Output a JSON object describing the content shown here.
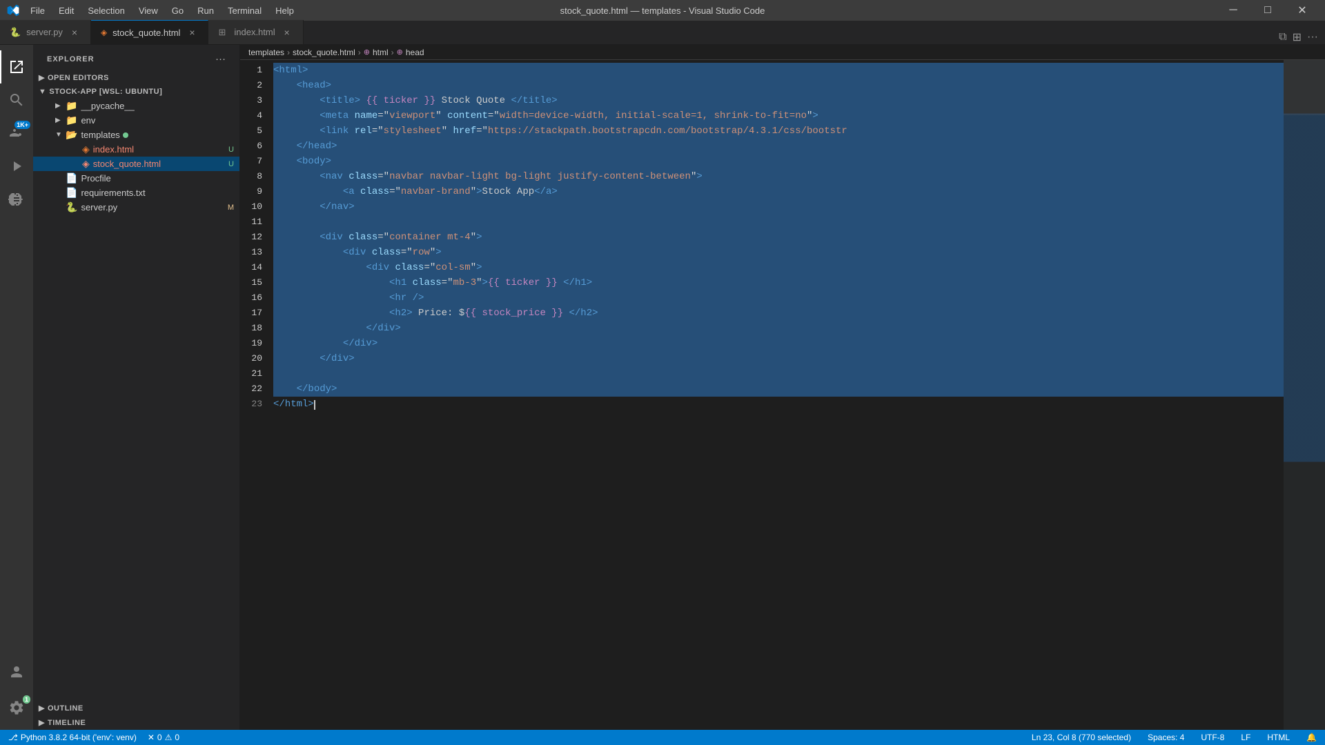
{
  "titleBar": {
    "title": "stock_quote.html — templates - Visual Studio Code",
    "menus": [
      "File",
      "Edit",
      "Selection",
      "View",
      "Go",
      "Run",
      "Terminal",
      "Help"
    ],
    "minimizeBtn": "─",
    "maximizeBtn": "□",
    "closeBtn": "✕"
  },
  "tabs": [
    {
      "id": "server-py",
      "label": "server.py",
      "icon": "py",
      "active": false,
      "modified": false
    },
    {
      "id": "stock-quote-html",
      "label": "stock_quote.html",
      "icon": "html",
      "active": true,
      "modified": false
    },
    {
      "id": "index-html",
      "label": "index.html",
      "icon": "html",
      "active": false,
      "modified": false
    }
  ],
  "activityBar": {
    "items": [
      {
        "id": "explorer",
        "icon": "📄",
        "active": true,
        "label": "Explorer"
      },
      {
        "id": "search",
        "icon": "🔍",
        "label": "Search"
      },
      {
        "id": "source-control",
        "icon": "⑂",
        "label": "Source Control",
        "badge": "1K+"
      },
      {
        "id": "run",
        "icon": "▶",
        "label": "Run"
      },
      {
        "id": "extensions",
        "icon": "⊞",
        "label": "Extensions"
      }
    ],
    "bottomItems": [
      {
        "id": "account",
        "icon": "👤",
        "label": "Account"
      },
      {
        "id": "settings",
        "icon": "⚙",
        "label": "Settings",
        "badge": "1"
      }
    ]
  },
  "sidebar": {
    "title": "EXPLORER",
    "openEditorsSection": "OPEN EDITORS",
    "projectSection": "STOCK-APP [WSL: UBUNTU]",
    "files": [
      {
        "type": "folder",
        "name": "__pycache__",
        "indent": 1,
        "expanded": false
      },
      {
        "type": "folder",
        "name": "env",
        "indent": 1,
        "expanded": false
      },
      {
        "type": "folder",
        "name": "templates",
        "indent": 1,
        "expanded": true,
        "modified": true
      },
      {
        "type": "file",
        "name": "index.html",
        "indent": 2,
        "badge": "U",
        "error": true
      },
      {
        "type": "file",
        "name": "stock_quote.html",
        "indent": 2,
        "badge": "U",
        "error": true,
        "selected": true
      },
      {
        "type": "file",
        "name": "Procfile",
        "indent": 1
      },
      {
        "type": "file",
        "name": "requirements.txt",
        "indent": 1
      },
      {
        "type": "file",
        "name": "server.py",
        "indent": 1,
        "badge": "M"
      }
    ],
    "outlineSection": "OUTLINE",
    "timelineSection": "TIMELINE"
  },
  "breadcrumb": {
    "items": [
      "templates",
      "stock_quote.html",
      "html",
      "head"
    ]
  },
  "editor": {
    "lines": [
      {
        "num": 1,
        "content": "<html>",
        "selected": true
      },
      {
        "num": 2,
        "content": "    <head>",
        "selected": true
      },
      {
        "num": 3,
        "content": "        <title> {{ ticker }} Stock Quote </title>",
        "selected": true
      },
      {
        "num": 4,
        "content": "        <meta name=\"viewport\" content=\"width=device-width, initial-scale=1, shrink-to-fit=no\">",
        "selected": true
      },
      {
        "num": 5,
        "content": "        <link rel=\"stylesheet\" href=\"https://stackpath.bootstrapcdn.com/bootstrap/4.3.1/css/bootstr",
        "selected": true
      },
      {
        "num": 6,
        "content": "    </head>",
        "selected": true
      },
      {
        "num": 7,
        "content": "    <body>",
        "selected": true
      },
      {
        "num": 8,
        "content": "        <nav class=\"navbar navbar-light bg-light justify-content-between\">",
        "selected": true
      },
      {
        "num": 9,
        "content": "            <a class=\"navbar-brand\">Stock App</a>",
        "selected": true
      },
      {
        "num": 10,
        "content": "        </nav>",
        "selected": true
      },
      {
        "num": 11,
        "content": "",
        "selected": true
      },
      {
        "num": 12,
        "content": "        <div class=\"container mt-4\">",
        "selected": true
      },
      {
        "num": 13,
        "content": "            <div class=\"row\">",
        "selected": true
      },
      {
        "num": 14,
        "content": "                <div class=\"col-sm\">",
        "selected": true
      },
      {
        "num": 15,
        "content": "                    <h1 class=\"mb-3\">{{ ticker }} </h1>",
        "selected": true
      },
      {
        "num": 16,
        "content": "                    <hr />",
        "selected": true
      },
      {
        "num": 17,
        "content": "                    <h2> Price: ${{ stock_price }} </h2>",
        "selected": true
      },
      {
        "num": 18,
        "content": "                </div>",
        "selected": true
      },
      {
        "num": 19,
        "content": "            </div>",
        "selected": true
      },
      {
        "num": 20,
        "content": "        </div>",
        "selected": true
      },
      {
        "num": 21,
        "content": "",
        "selected": true
      },
      {
        "num": 22,
        "content": "    </body>",
        "selected": true
      },
      {
        "num": 23,
        "content": "</html>",
        "selected": false
      }
    ]
  },
  "statusBar": {
    "python": "Python 3.8.2 64-bit ('env': venv)",
    "errors": "0",
    "warnings": "0",
    "cursor": "Ln 23, Col 8 (770 selected)",
    "spaces": "Spaces: 4",
    "encoding": "UTF-8",
    "lineEnding": "LF",
    "language": "HTML",
    "feedback": "🔔"
  }
}
